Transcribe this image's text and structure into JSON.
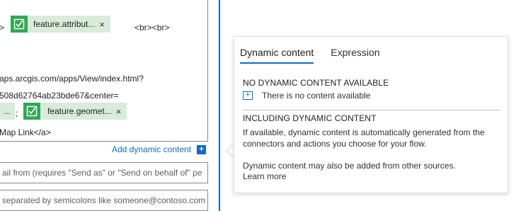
{
  "editor": {
    "line1_prefix": ">",
    "token1_label": "feature.attribut...",
    "token_close": "×",
    "line1_suffix": "<br><br>",
    "line2": "aps.arcgis.com/apps/View/index.html?",
    "line3": "508d62764ab23bde67&center=",
    "small_token_label": "...",
    "separator": ";",
    "token2_label": "feature.geomet...",
    "line5": "Map Link</a>",
    "add_dynamic_label": "Add dynamic content",
    "add_dynamic_icon": "+"
  },
  "fields": {
    "send_from_placeholder": "ail from (requires \"Send as\" or \"Send on behalf of\" pe",
    "cc_placeholder": "separated by semicolons like someone@contoso.com"
  },
  "flyout": {
    "tabs": [
      {
        "label": "Dynamic content",
        "active": true
      },
      {
        "label": "Expression",
        "active": false
      }
    ],
    "no_dynamic_title": "NO DYNAMIC CONTENT AVAILABLE",
    "no_content_icon": "+",
    "no_content_text": "There is no content available",
    "including_title": "INCLUDING DYNAMIC CONTENT",
    "including_text": "If available, dynamic content is automatically generated from the connectors and actions you choose for your flow.",
    "other_sources_text": "Dynamic content may also be added from other sources.",
    "learn_more": "Learn more"
  },
  "colors": {
    "accent": "#0f6cbd",
    "token_bg": "#d8ecd9",
    "token_icon_bg": "#33a853"
  }
}
